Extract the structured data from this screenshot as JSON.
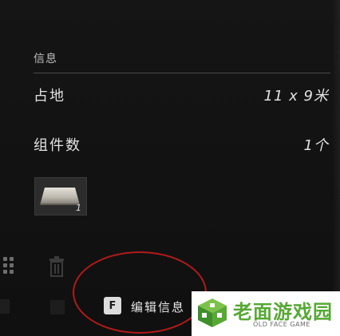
{
  "info_panel": {
    "section_title": "信息",
    "rows": [
      {
        "label": "占地",
        "value": "11 x 9米"
      },
      {
        "label": "组件数",
        "value": "1个"
      }
    ],
    "items": [
      {
        "icon": "stone-slab-component",
        "count": "1"
      }
    ]
  },
  "action": {
    "key": "F",
    "label": "编辑信息"
  },
  "watermark": {
    "name": "老面游戏园",
    "subtitle": "OLD FACE GAME",
    "color": "#57a835"
  },
  "colors": {
    "background": "#121212",
    "text": "#e2e2e2",
    "annotation": "#b11a1a"
  }
}
